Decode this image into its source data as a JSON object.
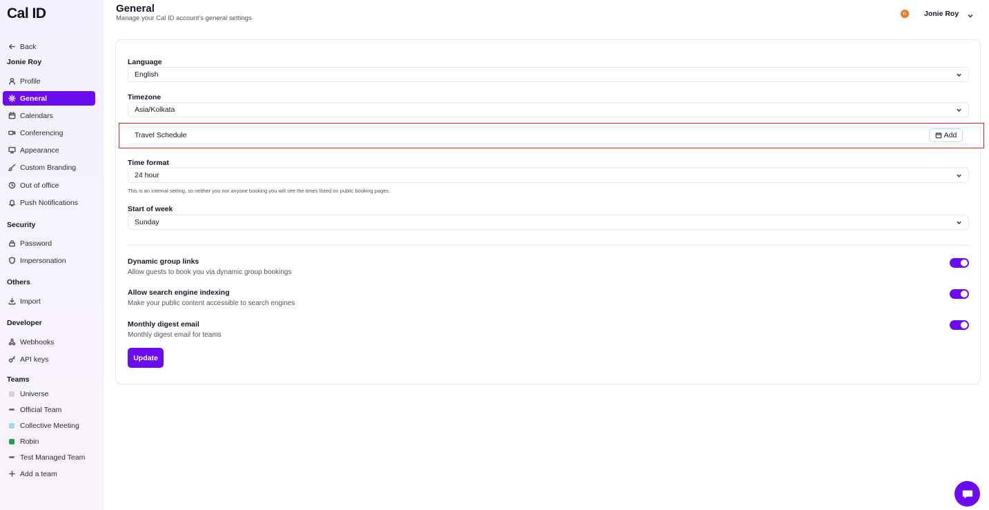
{
  "app": {
    "logo": "Cal ID"
  },
  "sidebar": {
    "back": "Back",
    "user_name": "Jonie Roy",
    "items": [
      {
        "label": "Profile",
        "icon": "user-icon"
      },
      {
        "label": "General",
        "icon": "gear-icon",
        "active": true
      },
      {
        "label": "Calendars",
        "icon": "calendar-icon"
      },
      {
        "label": "Conferencing",
        "icon": "video-icon"
      },
      {
        "label": "Appearance",
        "icon": "monitor-icon"
      },
      {
        "label": "Custom Branding",
        "icon": "brush-icon"
      },
      {
        "label": "Out of office",
        "icon": "clock-icon"
      },
      {
        "label": "Push Notifications",
        "icon": "bell-icon"
      }
    ],
    "security": {
      "title": "Security",
      "items": [
        {
          "label": "Password",
          "icon": "lock-icon"
        },
        {
          "label": "Impersonation",
          "icon": "shield-icon"
        }
      ]
    },
    "others": {
      "title": "Others",
      "items": [
        {
          "label": "Import",
          "icon": "download-icon"
        }
      ]
    },
    "developer": {
      "title": "Developer",
      "items": [
        {
          "label": "Webhooks",
          "icon": "webhook-icon"
        },
        {
          "label": "API keys",
          "icon": "key-icon"
        }
      ]
    },
    "teams": {
      "title": "Teams",
      "items": [
        {
          "label": "Universe",
          "color": "#d4d4d8"
        },
        {
          "label": "Official Team",
          "color": "#6b7280"
        },
        {
          "label": "Collective Meeting",
          "color": "#a5d8f3"
        },
        {
          "label": "Robin",
          "color": "#16a34a"
        },
        {
          "label": "Test Managed Team",
          "color": "#6b7280"
        }
      ],
      "add_label": "Add a team"
    }
  },
  "header": {
    "title": "General",
    "subtitle": "Manage your Cal ID account's general settings",
    "avatar_letter": "G",
    "user_name": "Jonie Roy"
  },
  "form": {
    "language": {
      "label": "Language",
      "value": "English"
    },
    "timezone": {
      "label": "Timezone",
      "value": "Asia/Kolkata"
    },
    "travel": {
      "label": "Travel Schedule",
      "add_label": "Add"
    },
    "time_format": {
      "label": "Time format",
      "value": "24 hour",
      "help": "This is an internal setting, so neither you nor anyone booking you will see the times listed on public booking pages."
    },
    "start_of_week": {
      "label": "Start of week",
      "value": "Sunday"
    },
    "toggles": [
      {
        "title": "Dynamic group links",
        "desc": "Allow guests to book you via dynamic group bookings",
        "on": true
      },
      {
        "title": "Allow search engine indexing",
        "desc": "Make your public content accessible to search engines",
        "on": true
      },
      {
        "title": "Monthly digest email",
        "desc": "Monthly digest email for teams",
        "on": true
      }
    ],
    "update_label": "Update"
  },
  "colors": {
    "accent": "#6a0bf0",
    "highlight": "#e11d2f"
  }
}
